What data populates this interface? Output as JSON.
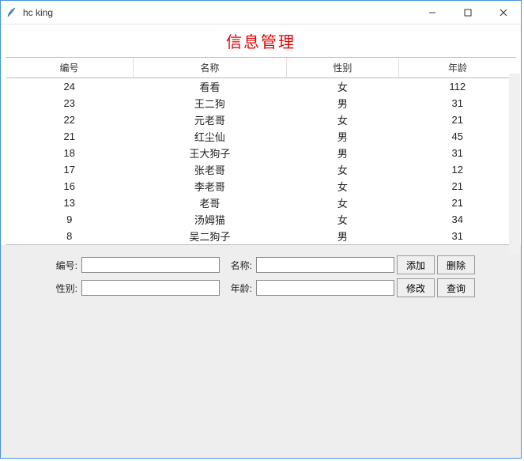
{
  "window": {
    "title": "hc king"
  },
  "heading": "信息管理",
  "columns": [
    "编号",
    "名称",
    "性别",
    "年龄"
  ],
  "rows": [
    {
      "id": "24",
      "name": "看看",
      "sex": "女",
      "age": "112"
    },
    {
      "id": "23",
      "name": "王二狗",
      "sex": "男",
      "age": "31"
    },
    {
      "id": "22",
      "name": "元老哥",
      "sex": "女",
      "age": "21"
    },
    {
      "id": "21",
      "name": "红尘仙",
      "sex": "男",
      "age": "45"
    },
    {
      "id": "18",
      "name": "王大狗子",
      "sex": "男",
      "age": "31"
    },
    {
      "id": "17",
      "name": "张老哥",
      "sex": "女",
      "age": "12"
    },
    {
      "id": "16",
      "name": "李老哥",
      "sex": "女",
      "age": "21"
    },
    {
      "id": "13",
      "name": "老哥",
      "sex": "女",
      "age": "21"
    },
    {
      "id": "9",
      "name": "汤姆猫",
      "sex": "女",
      "age": "34"
    },
    {
      "id": "8",
      "name": "吴二狗子",
      "sex": "男",
      "age": "31"
    }
  ],
  "form": {
    "id_label": "编号:",
    "name_label": "名称:",
    "sex_label": "性别:",
    "age_label": "年龄:",
    "id_value": "",
    "name_value": "",
    "sex_value": "",
    "age_value": ""
  },
  "buttons": {
    "add": "添加",
    "delete": "删除",
    "modify": "修改",
    "query": "查询"
  }
}
